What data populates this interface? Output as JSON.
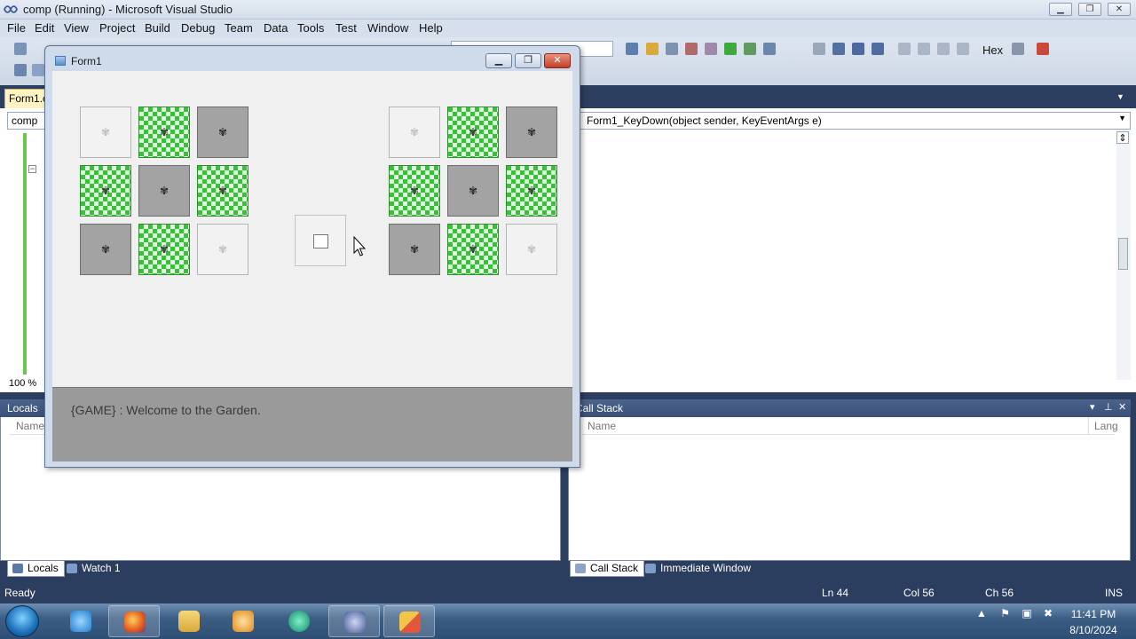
{
  "vs": {
    "title": "comp (Running) - Microsoft Visual Studio",
    "window_controls": {
      "minimize": "▁",
      "restore": "❐",
      "close": "✕"
    },
    "menu": [
      "File",
      "Edit",
      "View",
      "Project",
      "Build",
      "Debug",
      "Team",
      "Data",
      "Tools",
      "Test",
      "Window",
      "Help"
    ],
    "toolbar": {
      "hex_label": "Hex"
    },
    "tab": {
      "label": "Form1.cs"
    },
    "editor": {
      "nav_left": "comp",
      "nav_right": "Form1_KeyDown(object sender, KeyEventArgs e)",
      "zoom": "100 %"
    },
    "locals": {
      "title": "Locals",
      "col_name": "Name"
    },
    "callstack": {
      "title": "Call Stack",
      "col_name": "Name",
      "col_lang": "Lang"
    },
    "bottom_tabs_left": [
      "Locals",
      "Watch 1"
    ],
    "bottom_tabs_right": [
      "Call Stack",
      "Immediate Window"
    ],
    "status": {
      "ready": "Ready",
      "ln": "Ln 44",
      "col": "Col 56",
      "ch": "Ch 56",
      "mode": "INS"
    }
  },
  "form1": {
    "title": "Form1",
    "status_text": "{GAME} : Welcome to the Garden.",
    "left_grid": [
      [
        "empty",
        "grass",
        "stone"
      ],
      [
        "grass",
        "stone",
        "grass"
      ],
      [
        "stone",
        "grass",
        "empty"
      ]
    ],
    "right_grid": [
      [
        "empty",
        "grass",
        "stone"
      ],
      [
        "grass",
        "stone",
        "grass"
      ],
      [
        "stone",
        "grass",
        "empty"
      ]
    ]
  },
  "taskbar": {
    "apps": [
      "internet-explorer",
      "firefox",
      "file-explorer",
      "media-player",
      "app-green",
      "visual-studio",
      "form-app"
    ],
    "clock_time": "11:41 PM",
    "clock_date": "8/10/2024"
  },
  "colors": {
    "vs_dark": "#2c3e5f",
    "grass_green": "#35c235",
    "stone_gray": "#a3a3a3",
    "status_gray": "#9a9a9a",
    "line_green": "#6cc64e"
  }
}
